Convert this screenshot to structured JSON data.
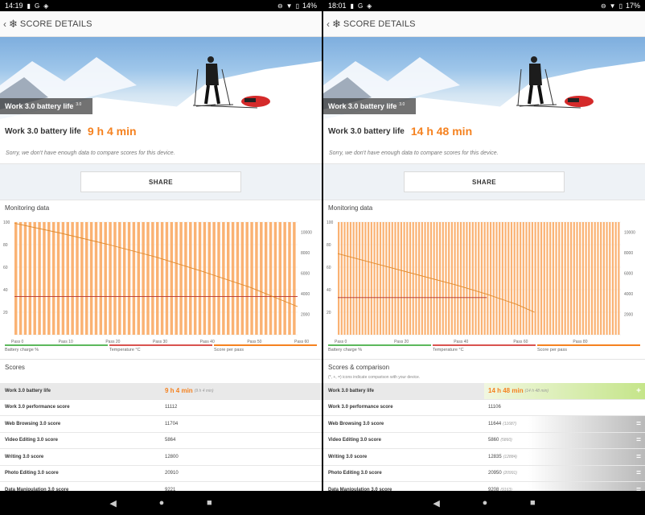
{
  "colors": {
    "accent": "#f58220",
    "battery": "#5cb85c",
    "temperature": "#d9534f",
    "score": "#f58220",
    "highlight_bar": "#c5e58a"
  },
  "icons": {
    "status_warning": "alert-icon",
    "status_g": "google-icon",
    "status_shield": "shield-icon",
    "battery": "battery-icon",
    "wifi": "wifi-icon",
    "dnd": "dnd-icon",
    "back": "back-arrow-icon",
    "logo": "snowflake-icon",
    "nav_back": "triangle-back-icon",
    "nav_home": "circle-home-icon",
    "nav_recent": "square-recent-icon"
  },
  "screens": [
    {
      "status": {
        "time": "14:19",
        "battery": "14%"
      },
      "header": {
        "title": "SCORE DETAILS"
      },
      "hero": {
        "label": "Work 3.0 battery life",
        "version": "3.0"
      },
      "result": {
        "name": "Work 3.0 battery life",
        "value": "9 h 4 min"
      },
      "sorry": "Sorry, we don't have enough data to compare scores for this device.",
      "share": "SHARE",
      "monitoring_title": "Monitoring data",
      "legend": [
        "Battery charge %",
        "Temperature °C",
        "Score per pass"
      ],
      "scores_title": "Scores",
      "scores_note": "",
      "rows": [
        {
          "name": "Work 3.0 battery life",
          "value": "9 h 4 min",
          "avg": "(9 h 4 min)"
        },
        {
          "name": "Work 3.0 performance score",
          "value": "11112",
          "avg": ""
        },
        {
          "name": "Web Browsing 3.0 score",
          "value": "11704",
          "avg": ""
        },
        {
          "name": "Video Editing 3.0 score",
          "value": "5864",
          "avg": ""
        },
        {
          "name": "Writing 3.0 score",
          "value": "12800",
          "avg": ""
        },
        {
          "name": "Photo Editing 3.0 score",
          "value": "20910",
          "avg": ""
        },
        {
          "name": "Data Manipulation 3.0 score",
          "value": "9221",
          "avg": ""
        }
      ]
    },
    {
      "status": {
        "time": "18:01",
        "battery": "17%"
      },
      "header": {
        "title": "SCORE DETAILS"
      },
      "hero": {
        "label": "Work 3.0 battery life",
        "version": "3.0"
      },
      "result": {
        "name": "Work 3.0 battery life",
        "value": "14 h 48 min"
      },
      "sorry": "Sorry, we don't have enough data to compare scores for this device.",
      "share": "SHARE",
      "monitoring_title": "Monitoring data",
      "legend": [
        "Battery charge %",
        "Temperature °C",
        "Score per pass"
      ],
      "scores_title": "Scores & comparison",
      "scores_note": "(*, +, =) icons indicate comparison with your device.",
      "rows": [
        {
          "name": "Work 3.0 battery life",
          "value": "14 h 48 min",
          "avg": "(14 h 48 min)"
        },
        {
          "name": "Work 3.0 performance score",
          "value": "11106",
          "avg": ""
        },
        {
          "name": "Web Browsing 3.0 score",
          "value": "11644",
          "avg": "(11687)"
        },
        {
          "name": "Video Editing 3.0 score",
          "value": "5860",
          "avg": "(5860)"
        },
        {
          "name": "Writing 3.0 score",
          "value": "12835",
          "avg": "(12884)"
        },
        {
          "name": "Photo Editing 3.0 score",
          "value": "20950",
          "avg": "(20991)"
        },
        {
          "name": "Data Manipulation 3.0 score",
          "value": "9208",
          "avg": "(9163)"
        }
      ],
      "row_ops": [
        "+",
        "",
        "=",
        "=",
        "=",
        "=",
        "="
      ]
    }
  ],
  "chart_data": [
    {
      "type": "line",
      "y_left_ticks": [
        "100",
        "80",
        "60",
        "40",
        "20"
      ],
      "y_right_ticks": [
        "10000",
        "8000",
        "6000",
        "4000",
        "2000"
      ],
      "x_ticks": [
        "Pass 0",
        "Pass 10",
        "Pass 20",
        "Pass 30",
        "Pass 40",
        "Pass 50",
        "Pass 60"
      ],
      "ylim_left": [
        0,
        100
      ],
      "ylim_right": [
        0,
        11000
      ],
      "xlim": [
        0,
        60
      ],
      "series": [
        {
          "name": "Battery charge %",
          "x": [
            0,
            10,
            20,
            30,
            40,
            50,
            60
          ],
          "values": [
            99,
            90,
            80,
            69,
            56,
            42,
            25
          ]
        },
        {
          "name": "Temperature °C",
          "x": [
            0,
            60
          ],
          "values": [
            34,
            34
          ]
        },
        {
          "name": "Score per pass",
          "x": [
            0,
            59
          ],
          "values": [
            11000,
            11000
          ]
        }
      ]
    },
    {
      "type": "line",
      "y_left_ticks": [
        "100",
        "80",
        "60",
        "40",
        "20"
      ],
      "y_right_ticks": [
        "10000",
        "8000",
        "6000",
        "4000",
        "2000"
      ],
      "x_ticks": [
        "Pass 0",
        "Pass 20",
        "Pass 40",
        "Pass 60",
        "Pass 80"
      ],
      "ylim_left": [
        0,
        100
      ],
      "ylim_right": [
        0,
        11000
      ],
      "xlim": [
        0,
        95
      ],
      "series": [
        {
          "name": "Battery charge %",
          "x": [
            0,
            20,
            40,
            50,
            60,
            66
          ],
          "values": [
            72,
            58,
            44,
            36,
            27,
            20
          ]
        },
        {
          "name": "Temperature °C",
          "x": [
            0,
            50
          ],
          "values": [
            33,
            33
          ]
        },
        {
          "name": "Score per pass",
          "x": [
            0,
            94
          ],
          "values": [
            11000,
            11000
          ]
        }
      ]
    }
  ]
}
